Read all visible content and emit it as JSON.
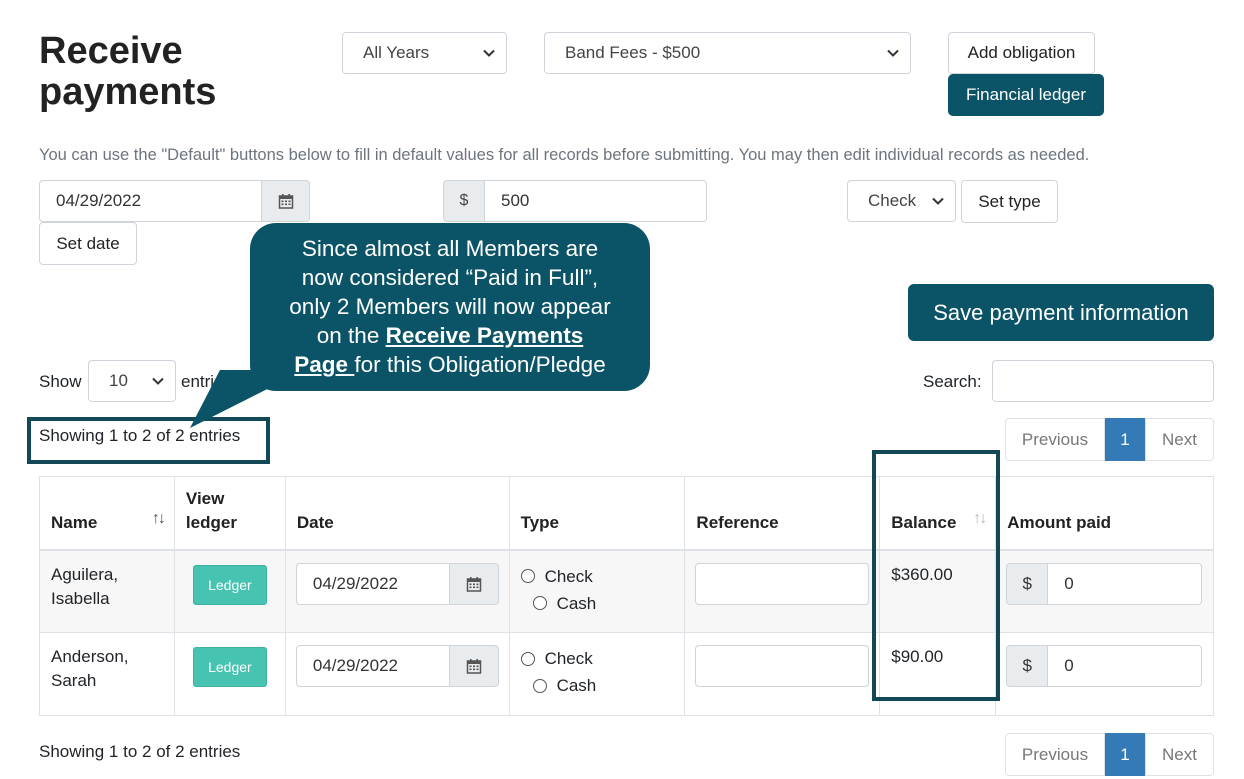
{
  "page": {
    "title_line1": "Receive",
    "title_line2": "payments"
  },
  "filters": {
    "year": "All Years",
    "obligation": "Band Fees - $500"
  },
  "buttons": {
    "add_obligation": "Add obligation",
    "financial_ledger": "Financial ledger",
    "save": "Save payment information",
    "set_date": "Set date",
    "set_type": "Set type"
  },
  "help_text": "You can use the \"Default\" buttons below to fill in default values for all records before submitting. You may then edit individual records as needed.",
  "defaults": {
    "date": "04/29/2022",
    "currency": "$",
    "amount": "500",
    "type": "Check"
  },
  "callout": {
    "line1": "Since almost all Members are",
    "line2": "now considered “Paid in Full”,",
    "line3": "only 2 Members will now appear",
    "line4_pre": "on the ",
    "link1": "Receive Payments",
    "link2": "Page ",
    "line5_post": "for this Obligation/Pledge"
  },
  "length": {
    "show": "Show",
    "value": "10",
    "entries": "entries"
  },
  "search": {
    "label": "Search:",
    "value": ""
  },
  "info": {
    "top": "Showing 1 to 2 of 2 entries",
    "bottom": "Showing 1 to 2 of 2 entries"
  },
  "pagination": {
    "previous": "Previous",
    "page": "1",
    "next": "Next"
  },
  "table": {
    "headers": {
      "name": "Name",
      "view_ledger_1": "View",
      "view_ledger_2": "ledger",
      "date": "Date",
      "type": "Type",
      "reference": "Reference",
      "balance": "Balance",
      "amount_paid": "Amount paid"
    },
    "rows": [
      {
        "last": "Aguilera,",
        "first": "Isabella",
        "ledger": "Ledger",
        "date": "04/29/2022",
        "type_check": "Check",
        "type_cash": "Cash",
        "reference": "",
        "balance": "$360.00",
        "currency": "$",
        "amount": "0"
      },
      {
        "last": "Anderson,",
        "first": "Sarah",
        "ledger": "Ledger",
        "date": "04/29/2022",
        "type_check": "Check",
        "type_cash": "Cash",
        "reference": "",
        "balance": "$90.00",
        "currency": "$",
        "amount": "0"
      }
    ]
  },
  "colors": {
    "teal": "#0b5467",
    "ledger_green": "#47c3b1",
    "page_active": "#337ab7"
  }
}
